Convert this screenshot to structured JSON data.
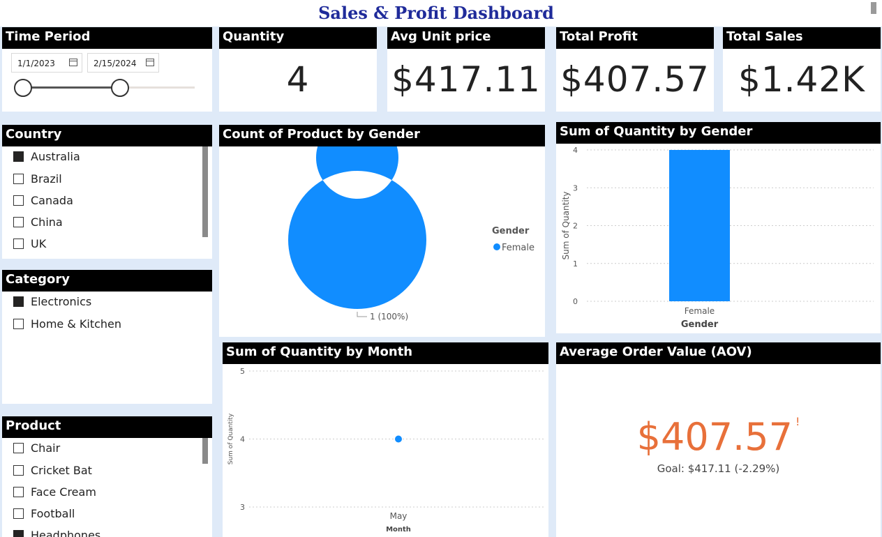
{
  "dashboard": {
    "title": "Sales & Profit Dashboard"
  },
  "time_period": {
    "header": "Time Period",
    "start_date": "1/1/2023",
    "end_date": "2/15/2024"
  },
  "kpis": {
    "quantity": {
      "label": "Quantity",
      "value": "4"
    },
    "avg_unit_price": {
      "label": "Avg Unit price",
      "value": "$417.11"
    },
    "total_profit": {
      "label": "Total Profit",
      "value": "$407.57"
    },
    "total_sales": {
      "label": "Total Sales",
      "value": "$1.42K"
    }
  },
  "country": {
    "header": "Country",
    "items": [
      {
        "label": "Australia",
        "checked": true
      },
      {
        "label": "Brazil",
        "checked": false
      },
      {
        "label": "Canada",
        "checked": false
      },
      {
        "label": "China",
        "checked": false
      },
      {
        "label": "UK",
        "checked": false
      }
    ]
  },
  "category": {
    "header": "Category",
    "items": [
      {
        "label": "Electronics",
        "checked": true
      },
      {
        "label": "Home & Kitchen",
        "checked": false
      }
    ]
  },
  "product": {
    "header": "Product",
    "items": [
      {
        "label": "Chair",
        "checked": false
      },
      {
        "label": "Cricket Bat",
        "checked": false
      },
      {
        "label": "Face Cream",
        "checked": false
      },
      {
        "label": "Football",
        "checked": false
      },
      {
        "label": "Headphones",
        "checked": true
      }
    ]
  },
  "aov": {
    "header": "Average Order Value (AOV)",
    "value": "$407.57",
    "alert": "!",
    "goal": "Goal: $417.11 (-2.29%)",
    "value_color": "#e8703a"
  },
  "colors": {
    "accent": "#118dff",
    "header_bg": "#000000",
    "title": "#1f2b9a"
  },
  "chart_data": [
    {
      "type": "pie",
      "title": "Count of Product by Gender",
      "legend_title": "Gender",
      "legend_position": "right",
      "categories": [
        "Female"
      ],
      "values": [
        1
      ],
      "data_labels": [
        "1 (100%)"
      ]
    },
    {
      "type": "bar",
      "title": "Sum of Quantity by Gender",
      "categories": [
        "Female"
      ],
      "values": [
        4
      ],
      "xlabel": "Gender",
      "ylabel": "Sum of Quantity",
      "ylim": [
        0,
        4
      ],
      "yticks": [
        "0",
        "1",
        "2",
        "3",
        "4"
      ],
      "grid": true
    },
    {
      "type": "scatter",
      "title": "Sum of Quantity by Month",
      "categories": [
        "May"
      ],
      "values": [
        4
      ],
      "xlabel": "Month",
      "ylabel": "Sum of Quantity",
      "ylim": [
        3,
        5
      ],
      "yticks": [
        "3",
        "4",
        "5"
      ],
      "grid": true
    }
  ]
}
